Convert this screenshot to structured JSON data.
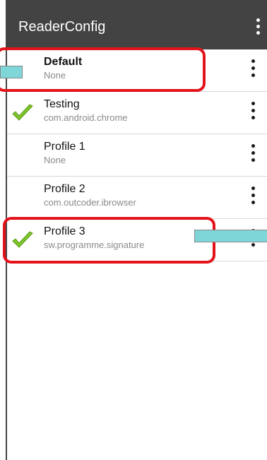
{
  "appbar": {
    "title": "ReaderConfig",
    "overflow_icon": "more-vert-icon"
  },
  "profiles": [
    {
      "title": "Default",
      "subtitle": "None",
      "checked": false,
      "bold": true
    },
    {
      "title": "Testing",
      "subtitle": "com.android.chrome",
      "checked": true,
      "bold": false
    },
    {
      "title": "Profile 1",
      "subtitle": "None",
      "checked": false,
      "bold": false
    },
    {
      "title": "Profile 2",
      "subtitle": "com.outcoder.ibrowser",
      "checked": false,
      "bold": false
    },
    {
      "title": "Profile 3",
      "subtitle": "sw.programme.signature",
      "checked": true,
      "bold": false
    }
  ],
  "colors": {
    "appbar_bg": "#434343",
    "check_green": "#7cc52a",
    "highlight_red": "#e3131b",
    "marker_teal": "#7fd6d9"
  }
}
